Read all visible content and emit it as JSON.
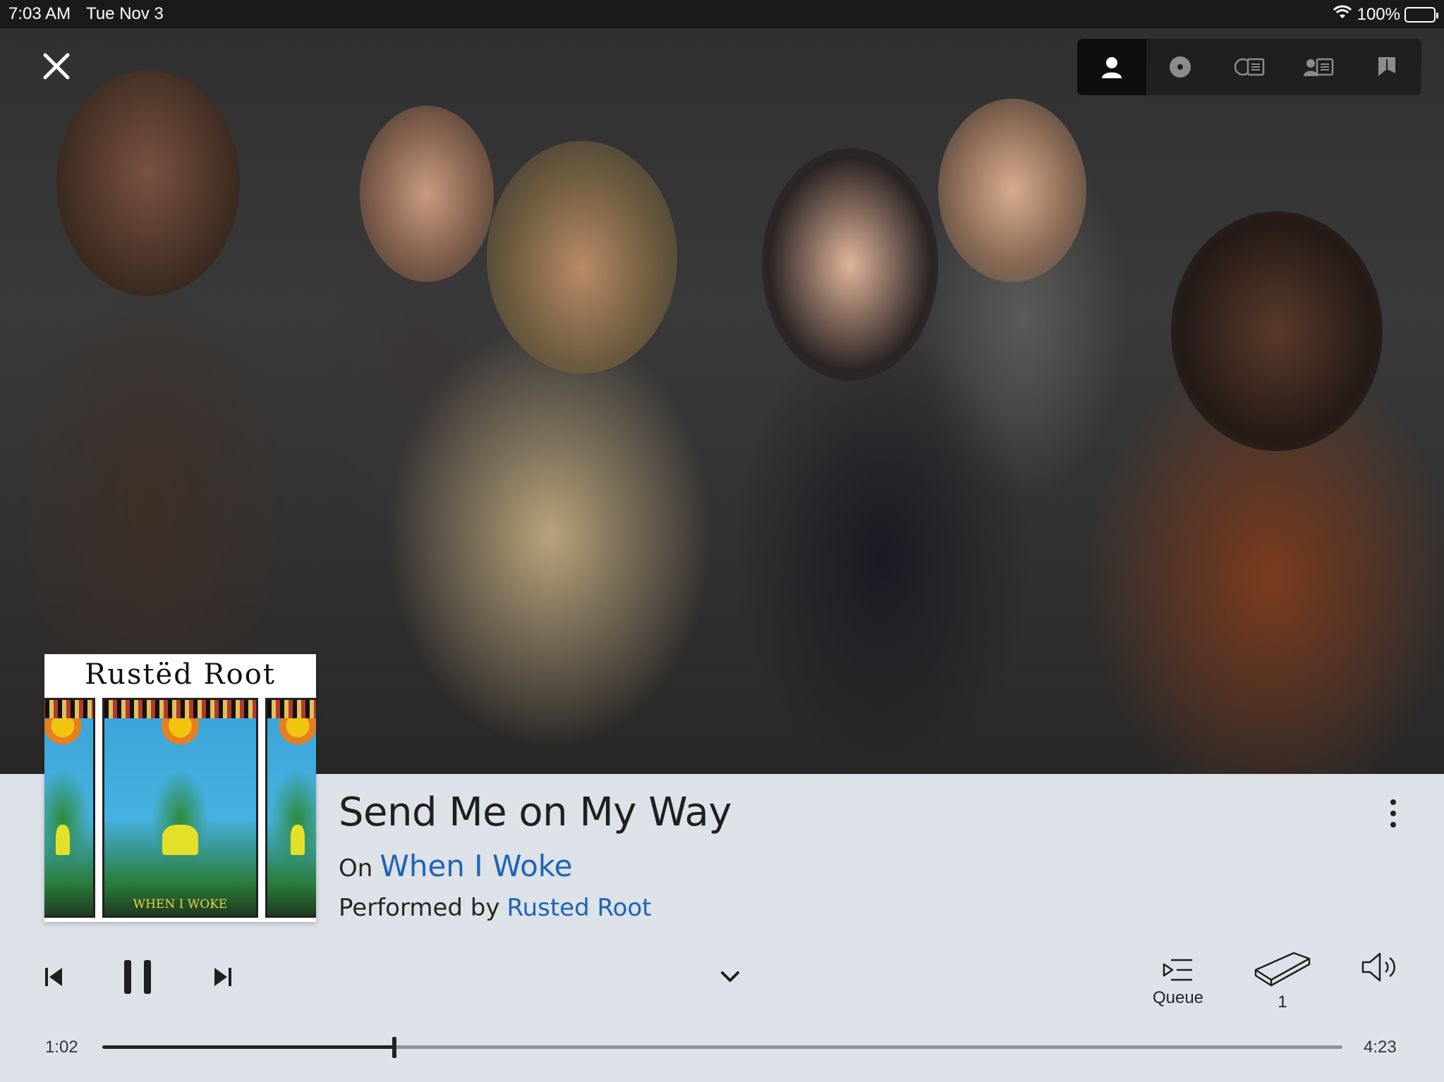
{
  "status_bar": {
    "time": "7:03 AM",
    "date": "Tue Nov 3",
    "battery": "100%",
    "icons": [
      "wifi-icon",
      "battery-icon"
    ]
  },
  "view_switcher": {
    "items": [
      {
        "name": "artist-view",
        "icon": "person-icon",
        "active": true
      },
      {
        "name": "album-view",
        "icon": "disc-icon",
        "active": false
      },
      {
        "name": "album-info-view",
        "icon": "disc-info-icon",
        "active": false
      },
      {
        "name": "artist-info-view",
        "icon": "person-info-icon",
        "active": false
      },
      {
        "name": "lyrics-view",
        "icon": "booklet-icon",
        "active": false
      }
    ]
  },
  "hero": {
    "image": "band-photo"
  },
  "album_art": {
    "band_text": "Rustëd Root",
    "album_text": "WHEN I WOKE"
  },
  "track": {
    "title": "Send Me on My Way",
    "album_prefix": "On",
    "album": "When I Woke",
    "artist_prefix": "Performed by",
    "artist": "Rusted Root"
  },
  "controls": {
    "queue_label": "Queue",
    "rooms_count": "1"
  },
  "progress": {
    "elapsed": "1:02",
    "total": "4:23",
    "fraction": 0.2357
  },
  "colors": {
    "panel_bg": "#dde1e8",
    "link": "#1f64b3",
    "text": "#1f1f1f"
  }
}
